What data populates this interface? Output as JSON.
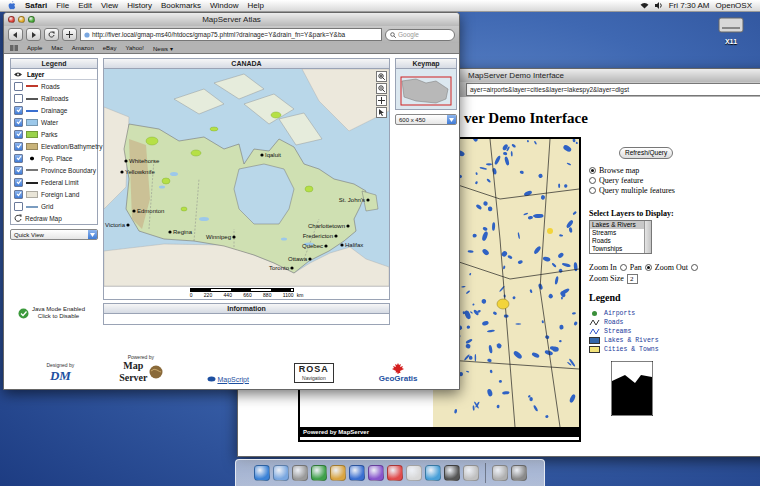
{
  "menu_bar": {
    "app": "Safari",
    "items": [
      "File",
      "Edit",
      "View",
      "History",
      "Bookmarks",
      "Window",
      "Help"
    ],
    "clock": "Fri 7:30 AM",
    "user": "OpenOSX"
  },
  "desktop": {
    "icons": [
      {
        "label": "X11"
      }
    ]
  },
  "atlas_window": {
    "title": "MapServer Atlas",
    "address": "http://fiver.local/gmap-ms40/htdocs/gmap75.phtml?drainage=Y&drain_fn=Y&park=Y&ba",
    "search_placeholder": "Google",
    "bookmarks": [
      "Apple",
      "Mac",
      "Amazon",
      "eBay",
      "Yahoo!",
      "News ▾"
    ],
    "legend": {
      "title": "Legend",
      "column": "Layer",
      "layers": [
        {
          "label": "Roads",
          "checked": false,
          "kind": "line",
          "color": "#c0392b"
        },
        {
          "label": "Railroads",
          "checked": false,
          "kind": "line",
          "color": "#555555"
        },
        {
          "label": "Drainage",
          "checked": true,
          "kind": "line",
          "color": "#3a6fd0"
        },
        {
          "label": "Water",
          "checked": true,
          "kind": "fill",
          "color": "#9cc8ea"
        },
        {
          "label": "Parks",
          "checked": true,
          "kind": "fill",
          "color": "#9ad24b"
        },
        {
          "label": "Elevation/Bathymetry",
          "checked": true,
          "kind": "fill",
          "color": "#c8b37a"
        },
        {
          "label": "Pop. Place",
          "checked": true,
          "kind": "dot",
          "color": "#000000"
        },
        {
          "label": "Province Boundary",
          "checked": true,
          "kind": "line",
          "color": "#777777"
        },
        {
          "label": "Federal Limit",
          "checked": true,
          "kind": "line",
          "color": "#222222"
        },
        {
          "label": "Foreign Land",
          "checked": true,
          "kind": "fill",
          "color": "#e9e5d8"
        },
        {
          "label": "Grid",
          "checked": false,
          "kind": "line",
          "color": "#7a9cc0"
        }
      ],
      "redraw": "Redraw Map"
    },
    "quick_view": "Quick View",
    "map": {
      "title": "CANADA",
      "places": [
        "Whitehorse",
        "Yellowknife",
        "Edmonton",
        "Victoria",
        "Regina",
        "Winnipeg",
        "Iqaluit",
        "St. John's",
        "Charlottetown",
        "Fredericton",
        "Halifax",
        "Quebec",
        "Ottawa",
        "Toronto"
      ],
      "scale": {
        "ticks": [
          "0",
          "220",
          "440",
          "660",
          "880",
          "1100"
        ],
        "unit": "km"
      }
    },
    "keymap": {
      "title": "Keymap",
      "size": "600 x 450"
    },
    "information": {
      "title": "Information"
    },
    "java_mode": {
      "status": "Java Mode Enabled",
      "action": "Click to Disable"
    },
    "logos": [
      {
        "kind": "dm",
        "lines": [
          "Designed by",
          "DM"
        ]
      },
      {
        "kind": "mapserver",
        "lines": [
          "Powered by",
          "Map",
          "Server"
        ]
      },
      {
        "kind": "mapscript",
        "lines": [
          "MapScript"
        ]
      },
      {
        "kind": "rosa",
        "lines": [
          "ROSA",
          "Navigation"
        ]
      },
      {
        "kind": "geogratis",
        "lines": [
          "GeoGratis"
        ]
      }
    ]
  },
  "demo_window": {
    "title": "MapServer Demo Interface",
    "address": "ayer=airports&layer=cities&layer=lakespy2&layer=dlgst",
    "heading": "ver Demo Interface",
    "map_footer": "Powered by MapServer",
    "refresh": "Refresh/Query",
    "modes": [
      {
        "label": "Browse map",
        "selected": true
      },
      {
        "label": "Query feature",
        "selected": false
      },
      {
        "label": "Query multiple features",
        "selected": false
      }
    ],
    "layers_label": "Select Layers to Display:",
    "layers": [
      {
        "label": "Lakes & Rivers",
        "selected": true
      },
      {
        "label": "Streams",
        "selected": false
      },
      {
        "label": "Roads",
        "selected": false
      },
      {
        "label": "Townships",
        "selected": false
      }
    ],
    "zoom": [
      {
        "label": "Zoom In",
        "selected": false
      },
      {
        "label": "Pan",
        "selected": true
      },
      {
        "label": "Zoom Out",
        "selected": false
      }
    ],
    "zoom_size": {
      "label": "Zoom Size",
      "value": "2"
    },
    "legend": {
      "title": "Legend",
      "items": [
        {
          "label": "Airports",
          "kind": "point",
          "color": "#3a8f3a"
        },
        {
          "label": "Roads",
          "kind": "line",
          "color": "#333333"
        },
        {
          "label": "Streams",
          "kind": "line",
          "color": "#3355cc"
        },
        {
          "label": "Lakes & Rivers",
          "kind": "fill",
          "color": "#3366aa"
        },
        {
          "label": "Cities & Towns",
          "kind": "fill",
          "color": "#f2e27a"
        }
      ]
    }
  }
}
